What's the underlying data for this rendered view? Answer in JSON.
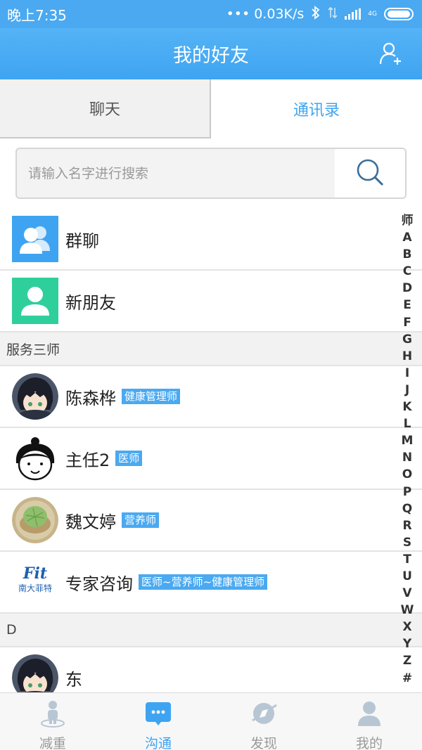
{
  "status_bar": {
    "time": "晚上7:35",
    "speed": "••• 0.03K/s",
    "net_tag": "4G"
  },
  "header": {
    "title": "我的好友"
  },
  "tabs": [
    {
      "label": "聊天",
      "active": false
    },
    {
      "label": "通讯录",
      "active": true
    }
  ],
  "search": {
    "placeholder": "请输入名字进行搜索",
    "value": ""
  },
  "fixed_items": [
    {
      "label": "群聊",
      "icon": "group-icon",
      "color": "#3ea4f1"
    },
    {
      "label": "新朋友",
      "icon": "person-icon",
      "color": "#2fcf9c"
    }
  ],
  "sections": [
    {
      "header": "服务三师",
      "contacts": [
        {
          "name": "陈森桦",
          "role": "健康管理师",
          "avatar": "anime-avatar"
        },
        {
          "name": "主任2",
          "role": "医师",
          "avatar": "cartoon-face-avatar"
        },
        {
          "name": "魏文婷",
          "role": "营养师",
          "avatar": "food-photo-avatar"
        },
        {
          "name": "专家咨询",
          "role": "医师~营养师~健康管理师",
          "avatar": "logo-avatar",
          "logo_top": "Fit",
          "logo_bottom": "南大菲特"
        }
      ]
    },
    {
      "header": "D",
      "contacts": [
        {
          "name": "东",
          "role": "",
          "avatar": "anime-avatar"
        }
      ]
    }
  ],
  "index_bar": [
    "师",
    "A",
    "B",
    "C",
    "D",
    "E",
    "F",
    "G",
    "H",
    "I",
    "J",
    "K",
    "L",
    "M",
    "N",
    "O",
    "P",
    "Q",
    "R",
    "S",
    "T",
    "U",
    "V",
    "W",
    "X",
    "Y",
    "Z",
    "#"
  ],
  "bottom_nav": [
    {
      "label": "减重",
      "icon": "weight-person-icon",
      "active": false
    },
    {
      "label": "沟通",
      "icon": "chat-bubble-icon",
      "active": true
    },
    {
      "label": "发现",
      "icon": "compass-icon",
      "active": false
    },
    {
      "label": "我的",
      "icon": "profile-icon",
      "active": false
    }
  ],
  "colors": {
    "brand": "#3ea4f1",
    "green": "#2fcf9c",
    "inactive": "#9a9a9a"
  }
}
